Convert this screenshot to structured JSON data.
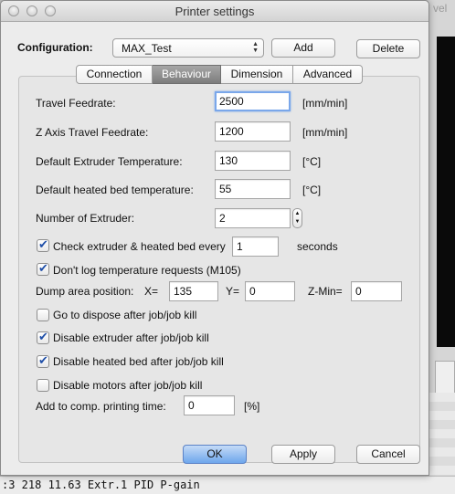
{
  "window": {
    "title": "Printer settings"
  },
  "background": {
    "right_fragment": "vel",
    "console_line": ":3 218 11.63 Extr.1 PID P-gain"
  },
  "config": {
    "label": "Configuration:",
    "selected": "MAX_Test",
    "add": "Add",
    "delete": "Delete"
  },
  "tabs": [
    {
      "label": "Connection"
    },
    {
      "label": "Behaviour",
      "active": true
    },
    {
      "label": "Dimension"
    },
    {
      "label": "Advanced"
    }
  ],
  "fields": {
    "travel": {
      "label": "Travel Feedrate:",
      "value": "2500",
      "unit": "[mm/min]"
    },
    "zaxis": {
      "label": "Z Axis Travel Feedrate:",
      "value": "1200",
      "unit": "[mm/min]"
    },
    "extruder_temp": {
      "label": "Default Extruder Temperature:",
      "value": "130",
      "unit": "[°C]"
    },
    "bed_temp": {
      "label": "Default heated bed temperature:",
      "value": "55",
      "unit": "[°C]"
    },
    "num_extruder": {
      "label": "Number of Extruder:",
      "value": "2"
    }
  },
  "check_every": {
    "label": "Check extruder & heated bed every",
    "value": "1",
    "unit": "seconds",
    "checked": true
  },
  "dont_log": {
    "label": "Don't log temperature requests (M105)",
    "checked": true
  },
  "dump": {
    "label": "Dump area position:",
    "x_label": "X=",
    "x": "135",
    "y_label": "Y=",
    "y": "0",
    "zmin_label": "Z-Min=",
    "zmin": "0"
  },
  "options": [
    {
      "label": "Go to dispose after job/job kill",
      "checked": false
    },
    {
      "label": "Disable extruder after job/job kill",
      "checked": true
    },
    {
      "label": "Disable heated bed after job/job kill",
      "checked": true
    },
    {
      "label": "Disable motors after job/job kill",
      "checked": false
    }
  ],
  "comp_time": {
    "label": "Add to comp. printing time:",
    "value": "0",
    "unit": "[%]"
  },
  "footer": {
    "ok": "OK",
    "apply": "Apply",
    "cancel": "Cancel"
  }
}
